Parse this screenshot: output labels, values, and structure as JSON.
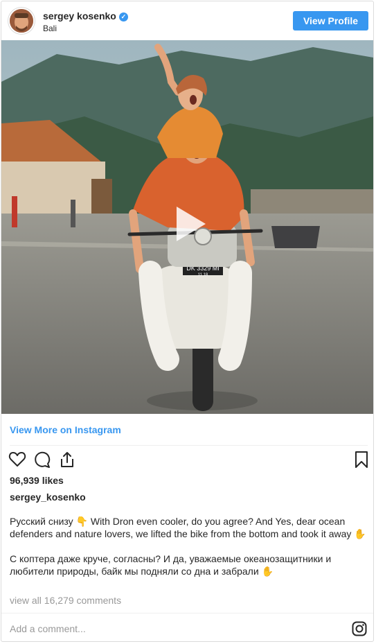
{
  "header": {
    "username": "sergey_kosenko_display",
    "username_text": "sergey  kosenko",
    "verified_symbol": "✓",
    "location": "Bali",
    "view_profile_label": "View Profile"
  },
  "media": {
    "plate_text_line1": "DK 3329 MI",
    "plate_text_line2": "11 18",
    "icon": "play-icon"
  },
  "links": {
    "view_more": "View More on Instagram"
  },
  "actions": {
    "icons": [
      "heart-icon",
      "comment-icon",
      "share-icon",
      "bookmark-icon"
    ]
  },
  "post": {
    "likes": "96,939 likes",
    "owner": "sergey_kosenko",
    "caption_en": "Русский снизу 👇 With Dron even cooler, do you agree? And Yes, dear ocean defenders and nature lovers, we lifted the bike from the bottom and took it away ✋",
    "caption_ru": "С коптера даже круче, согласны? И да, уважаемые океанозащитники и любители природы, байк мы подняли со дна и забрали ✋",
    "comments": "view all 16,279 comments"
  },
  "comment_box": {
    "placeholder": "Add a comment..."
  },
  "colors": {
    "accent": "#3897f0",
    "text": "#262626",
    "muted": "#999999",
    "border": "#dbdbdb"
  }
}
